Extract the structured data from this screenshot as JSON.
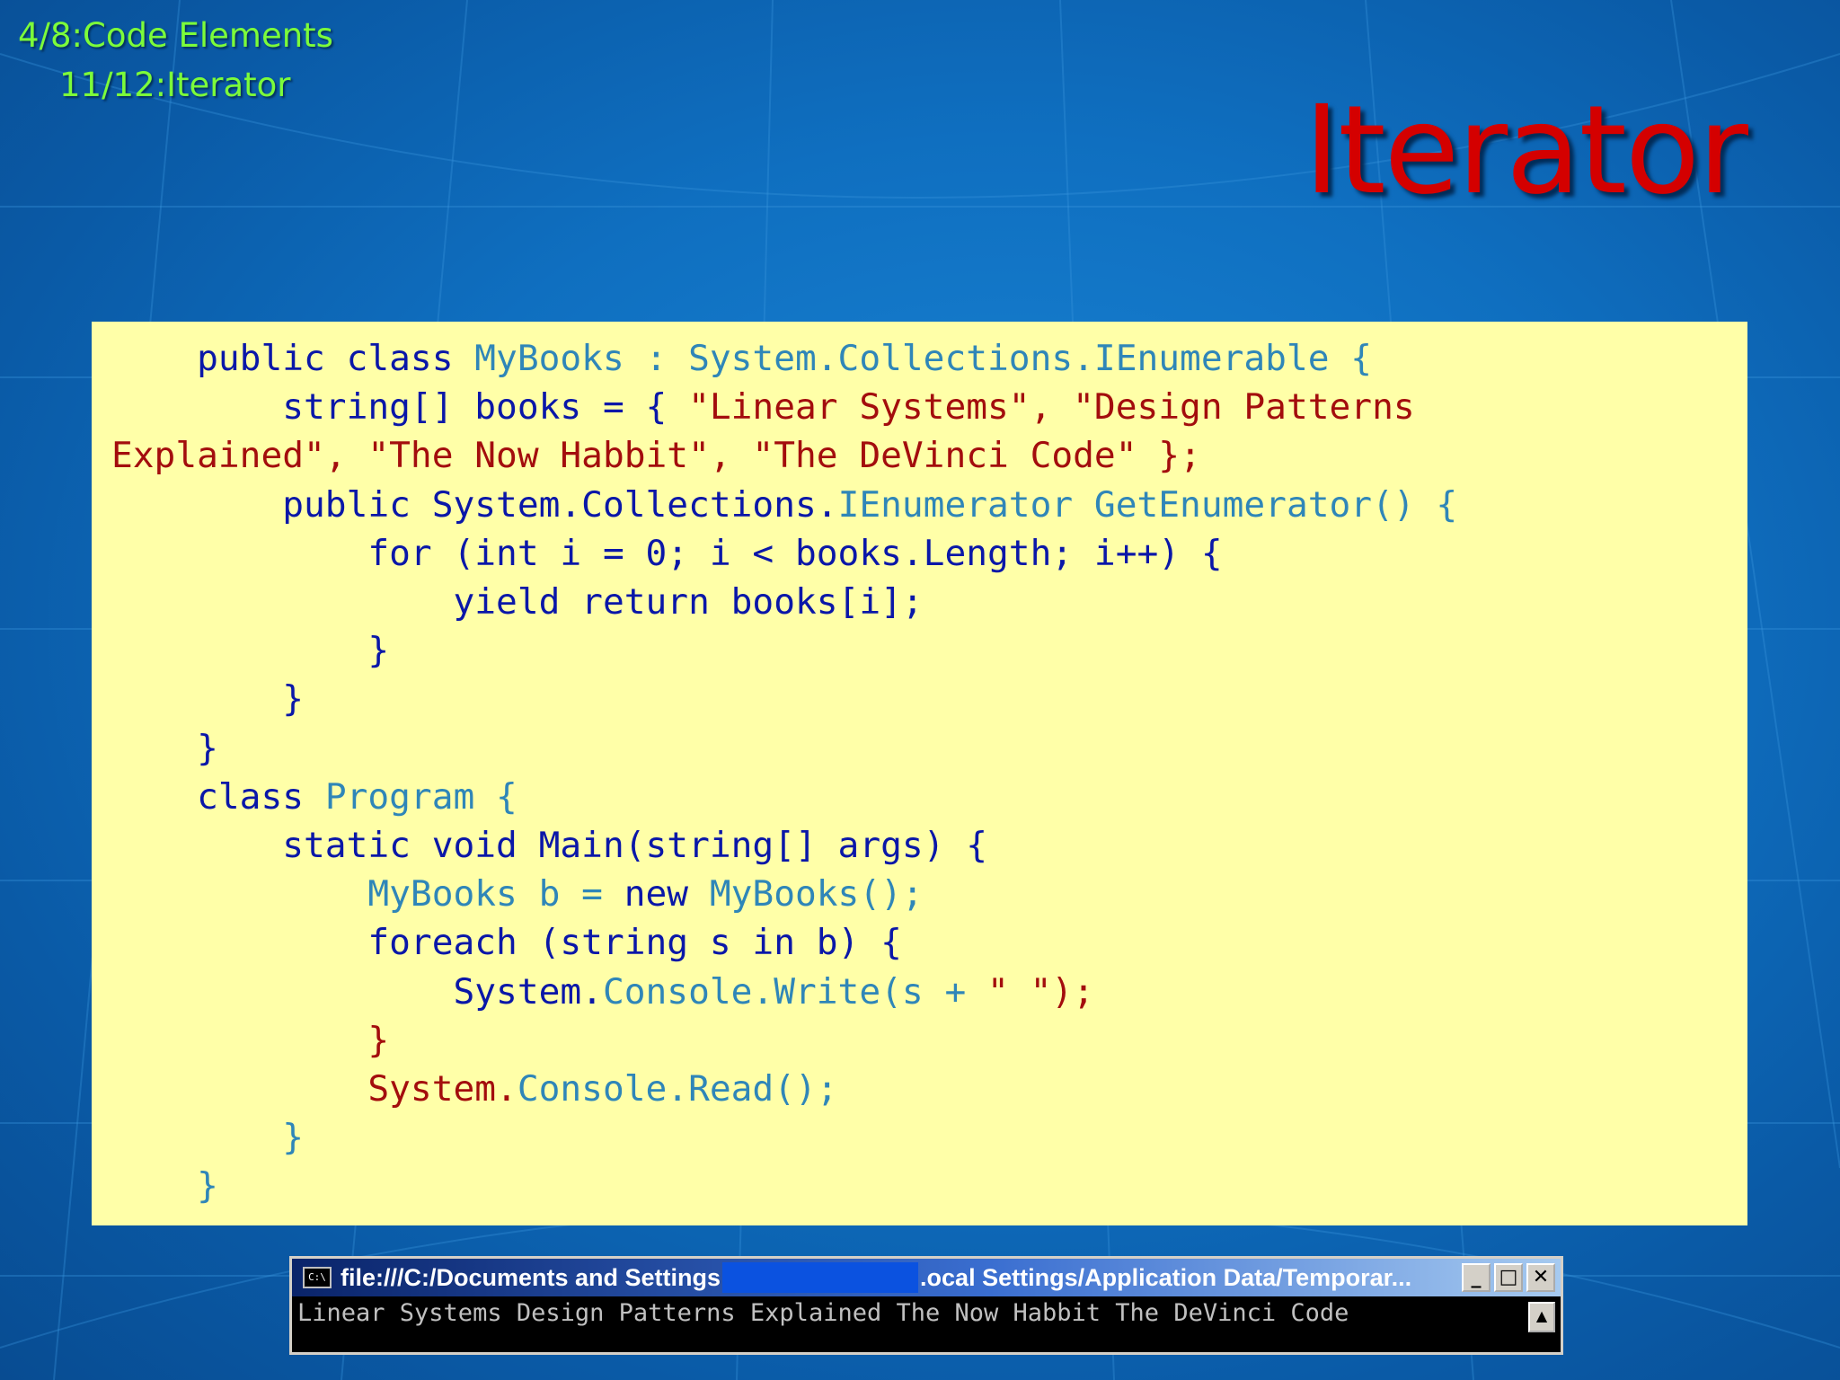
{
  "breadcrumbs": {
    "level1": "4/8:Code Elements",
    "level2": "11/12:Iterator"
  },
  "slide_title": "Iterator",
  "code": {
    "l1": {
      "a": "    public class ",
      "b": "MyBooks : System.Collections.IEnumerable {"
    },
    "l2": {
      "a": "        string[] books = { ",
      "b": "\"Linear Systems\", \"Design Patterns"
    },
    "l3": {
      "a": "Explained\", \"The Now Habbit\", \"The DeVinci Code\" };"
    },
    "l4": {
      "a": "        public System.Collections.",
      "b": "IEnumerator GetEnumerator() {"
    },
    "l5": {
      "a": "            for (int i = 0; i < books.Length; i++) {"
    },
    "l6": {
      "a": "                yield return books[i];"
    },
    "l7": {
      "a": "            }"
    },
    "l8": {
      "a": "        }"
    },
    "l9": {
      "a": "    }"
    },
    "l10": {
      "a": "    class ",
      "b": "Program {"
    },
    "l11": {
      "a": "        static void Main(string[] args) {"
    },
    "l12": {
      "a": "            ",
      "b": "MyBooks b = ",
      "c": "new ",
      "d": "MyBooks();"
    },
    "l13": {
      "a": "            foreach (string s in b) {"
    },
    "l14": {
      "a": "                System.",
      "b": "Console.Write(s + ",
      "c": "\" \");"
    },
    "l15": {
      "a": "            }"
    },
    "l16": {
      "a": "            System.",
      "b": "Console.Read();"
    },
    "l17": {
      "a": "        }"
    },
    "l18": {
      "a": "    }"
    }
  },
  "console_window": {
    "icon_label": "C:\\",
    "title_left": "file:///C:/Documents and Settings",
    "title_right": ".ocal Settings/Application Data/Temporar...",
    "minimize": "_",
    "maximize": "□",
    "close": "✕",
    "output": "Linear Systems Design Patterns Explained The Now Habbit The DeVinci Code",
    "scroll_up": "▲"
  },
  "colors": {
    "background": "#0f6fc0",
    "breadcrumb": "#7CFC3A",
    "title": "#d40000",
    "code_panel": "#ffffa8",
    "keyword": "#0a17a8",
    "identifier": "#2f86b8",
    "string": "#a30d0d"
  }
}
